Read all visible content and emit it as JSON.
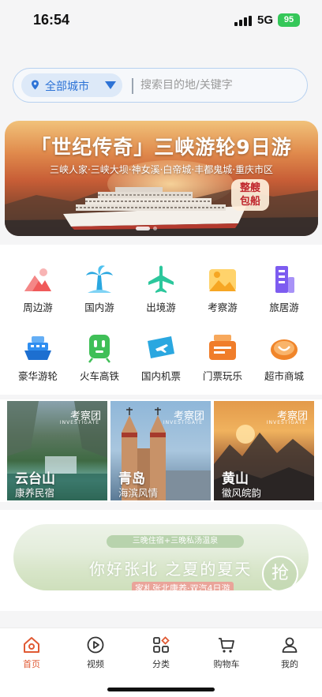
{
  "status_bar": {
    "time": "16:54",
    "network": "5G",
    "battery": "95"
  },
  "search": {
    "city": "全部城市",
    "placeholder": "搜索目的地/关键字"
  },
  "banner": {
    "title": "「世纪传奇」三峡游轮9日游",
    "subtitle": "三峡人家·三峡大坝·神女溪·白帝城·丰都鬼城·重庆市区",
    "badge_line1": "整艘",
    "badge_line2": "包船"
  },
  "categories": [
    {
      "label": "周边游",
      "icon": "mountain-icon",
      "color": "#f05a5a"
    },
    {
      "label": "国内游",
      "icon": "palm-tree-icon",
      "color": "#2aa7e0"
    },
    {
      "label": "出境游",
      "icon": "airplane-icon",
      "color": "#2cc79c"
    },
    {
      "label": "考察游",
      "icon": "landscape-icon",
      "color": "#f6a623"
    },
    {
      "label": "旅居游",
      "icon": "building-icon",
      "color": "#7d5cf0"
    },
    {
      "label": "豪华游轮",
      "icon": "cruise-ship-icon",
      "color": "#2f8ef0"
    },
    {
      "label": "火车高铁",
      "icon": "train-icon",
      "color": "#3fbf57"
    },
    {
      "label": "国内机票",
      "icon": "ticket-plane-icon",
      "color": "#2aa7e0"
    },
    {
      "label": "门票玩乐",
      "icon": "ticket-icon",
      "color": "#f07d2a"
    },
    {
      "label": "超市商城",
      "icon": "shopping-icon",
      "color": "#f0852a"
    }
  ],
  "feature_cards": [
    {
      "title": "云台山",
      "subtitle": "康养民宿",
      "tag": "考察团",
      "tag_sub": "INVESTIGATE"
    },
    {
      "title": "青岛",
      "subtitle": "海滨风情",
      "tag": "考察团",
      "tag_sub": "INVESTIGATE"
    },
    {
      "title": "黄山",
      "subtitle": "徽风皖韵",
      "tag": "考察团",
      "tag_sub": "INVESTIGATE"
    }
  ],
  "promo": {
    "top": "三晚住宿+三晚私汤温泉",
    "main": "你好张北 之夏的夏天",
    "sub": "家札张北康养·双汽4日游",
    "button": "抢"
  },
  "tabs": [
    {
      "label": "首页",
      "icon": "home-icon",
      "active": true
    },
    {
      "label": "视频",
      "icon": "play-icon",
      "active": false
    },
    {
      "label": "分类",
      "icon": "category-grid-icon",
      "active": false
    },
    {
      "label": "购物车",
      "icon": "cart-icon",
      "active": false
    },
    {
      "label": "我的",
      "icon": "user-icon",
      "active": false
    }
  ],
  "colors": {
    "accent": "#e05a34",
    "search_blue": "#2d73d6"
  }
}
